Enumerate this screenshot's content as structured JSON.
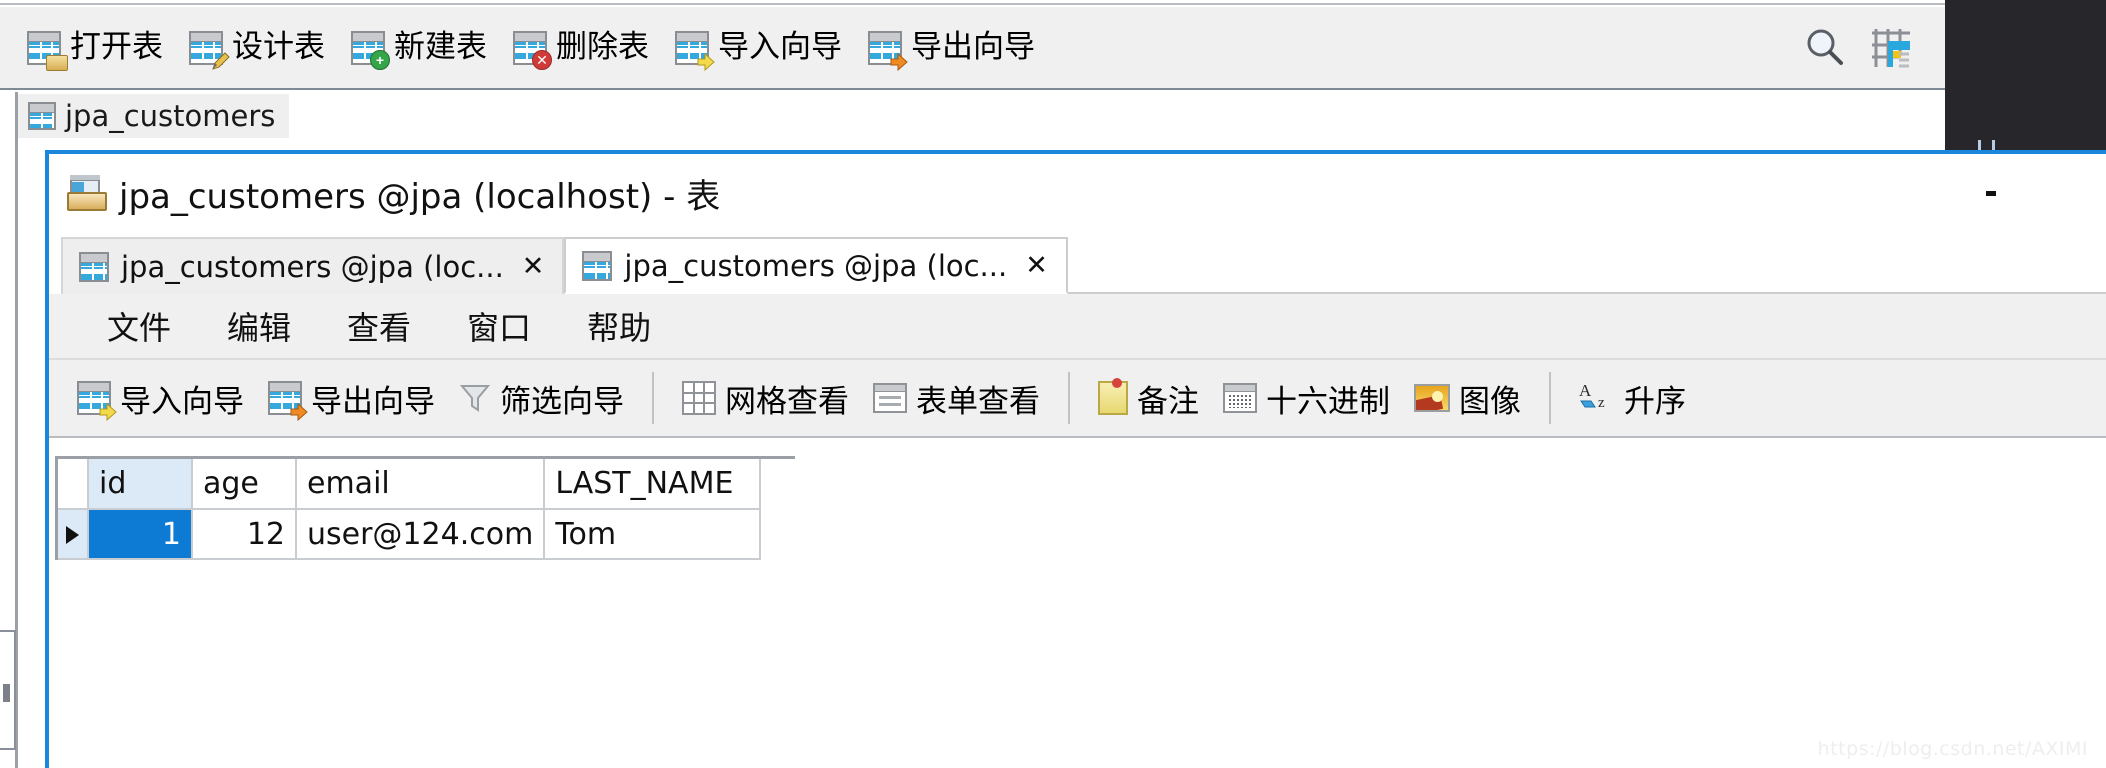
{
  "background_window": {
    "toolbar": {
      "buttons": [
        {
          "label": "打开表",
          "icon": "table-open-icon"
        },
        {
          "label": "设计表",
          "icon": "table-design-icon"
        },
        {
          "label": "新建表",
          "icon": "table-new-icon"
        },
        {
          "label": "删除表",
          "icon": "table-delete-icon"
        },
        {
          "label": "导入向导",
          "icon": "import-wizard-icon"
        },
        {
          "label": "导出向导",
          "icon": "export-wizard-icon"
        }
      ],
      "right_icons": [
        {
          "name": "search-icon",
          "label": ""
        },
        {
          "name": "grid-view-icon",
          "label": ""
        }
      ]
    },
    "tab": {
      "label": "jpa_customers",
      "icon": "table-icon"
    }
  },
  "foreground_window": {
    "title": "jpa_customers @jpa (localhost) - 表",
    "title_icon": "table-drawer-icon",
    "minimize_label": "−",
    "tabs": [
      {
        "label": "jpa_customers @jpa (loc...",
        "close": "✕",
        "active": false
      },
      {
        "label": "jpa_customers @jpa (loc...",
        "close": "✕",
        "active": true
      }
    ],
    "menu": [
      {
        "label": "文件"
      },
      {
        "label": "编辑"
      },
      {
        "label": "查看"
      },
      {
        "label": "窗口"
      },
      {
        "label": "帮助"
      }
    ],
    "toolbar": [
      {
        "label": "导入向导",
        "icon": "import-wizard-icon"
      },
      {
        "label": "导出向导",
        "icon": "export-wizard-icon"
      },
      {
        "label": "筛选向导",
        "icon": "filter-funnel-icon"
      },
      {
        "label": "网格查看",
        "icon": "grid-view-icon"
      },
      {
        "label": "表单查看",
        "icon": "form-view-icon"
      },
      {
        "label": "备注",
        "icon": "memo-note-icon"
      },
      {
        "label": "十六进制",
        "icon": "hex-icon"
      },
      {
        "label": "图像",
        "icon": "image-icon"
      },
      {
        "label": "升序",
        "icon": "sort-ascending-icon"
      }
    ],
    "grid": {
      "columns": [
        "id",
        "age",
        "email",
        "LAST_NAME"
      ],
      "rows": [
        {
          "id": "1",
          "age": "12",
          "email": "user@124.com",
          "LAST_NAME": "Tom"
        }
      ],
      "selected_column": "id",
      "selected_cell": "1",
      "row_marker": "▶"
    }
  },
  "watermark": "https://blog.csdn.net/AXIMI",
  "colors": {
    "accent_blue": "#1b87dc",
    "selection_blue": "#0d7ad4",
    "header_highlight": "#dce9f7",
    "toolbar_bg": "#f0f0f0",
    "desktop_dark": "#26262b"
  }
}
